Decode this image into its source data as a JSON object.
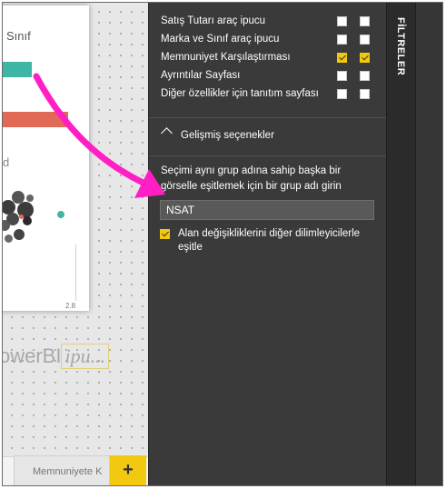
{
  "canvas": {
    "card_title": "Sınıf",
    "card_letter": "d",
    "axis_tick": "2.8",
    "brand_text": "owerBI",
    "brand_boxed": "ipu..."
  },
  "page_tabs": {
    "tab_label": "Memnuniyete K",
    "add_label": "+"
  },
  "tooltip_rows": [
    {
      "label": "Satış Tutarı araç ipucu",
      "checked1": false,
      "checked2": false
    },
    {
      "label": "Marka ve Sınıf araç ipucu",
      "checked1": false,
      "checked2": false
    },
    {
      "label": "Memnuniyet Karşılaştırması",
      "checked1": true,
      "checked2": true
    },
    {
      "label": "Ayrıntılar Sayfası",
      "checked1": false,
      "checked2": false
    },
    {
      "label": "Diğer özellikler için tanıtım sayfası",
      "checked1": false,
      "checked2": false
    }
  ],
  "advanced": {
    "title": "Gelişmiş seçenekler",
    "description": "Seçimi aynı grup adına sahip başka bir görselle eşitlemek için bir grup adı girin",
    "group_name_value": "NSAT",
    "sync_checked": true,
    "sync_label": "Alan değişikliklerini diğer dilimleyicilerle eşitle"
  },
  "filters_label": "FİLTRELER",
  "colors": {
    "accent": "#f2c811",
    "pane_bg": "#3a3a3a",
    "arrow": "#ff1fc4",
    "teal": "#3fb5a6",
    "coral": "#e06a55"
  }
}
